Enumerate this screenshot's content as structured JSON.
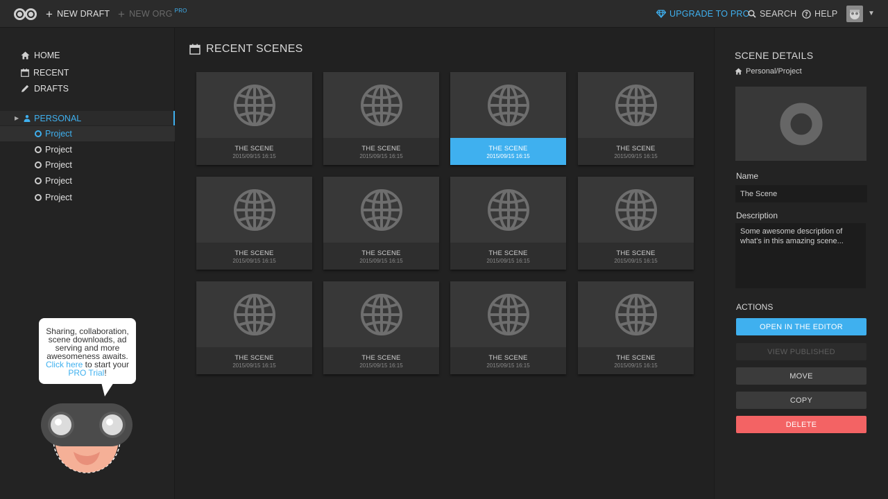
{
  "topbar": {
    "new_draft": "NEW DRAFT",
    "new_org": "NEW ORG",
    "pro_tag": "PRO",
    "upgrade": "UPGRADE TO PRO",
    "search": "SEARCH",
    "help": "HELP"
  },
  "sidebar": {
    "nav": [
      {
        "label": "HOME",
        "icon": "home-icon"
      },
      {
        "label": "RECENT",
        "icon": "calendar-icon"
      },
      {
        "label": "DRAFTS",
        "icon": "pencil-icon"
      }
    ],
    "personal": "PERSONAL",
    "projects": [
      {
        "label": "Project",
        "selected": true
      },
      {
        "label": "Project",
        "selected": false
      },
      {
        "label": "Project",
        "selected": false
      },
      {
        "label": "Project",
        "selected": false
      },
      {
        "label": "Project",
        "selected": false
      }
    ],
    "promo": {
      "text1": "Sharing, collaboration, scene downloads, ad serving and more awesomeness awaits.",
      "link1": "Click here",
      "text2": "to start your",
      "link2": "PRO Trial",
      "text3": "!"
    }
  },
  "main": {
    "title": "RECENT SCENES",
    "scenes": [
      {
        "title": "THE SCENE",
        "date": "2015/09/15 16:15",
        "active": false
      },
      {
        "title": "THE SCENE",
        "date": "2015/09/15 16:15",
        "active": false
      },
      {
        "title": "THE SCENE",
        "date": "2015/09/15 16:15",
        "active": true
      },
      {
        "title": "THE SCENE",
        "date": "2015/09/15 16:15",
        "active": false
      },
      {
        "title": "THE SCENE",
        "date": "2015/09/15 16:15",
        "active": false
      },
      {
        "title": "THE SCENE",
        "date": "2015/09/15 16:15",
        "active": false
      },
      {
        "title": "THE SCENE",
        "date": "2015/09/15 16:15",
        "active": false
      },
      {
        "title": "THE SCENE",
        "date": "2015/09/15 16:15",
        "active": false
      },
      {
        "title": "THE SCENE",
        "date": "2015/09/15 16:15",
        "active": false
      },
      {
        "title": "THE SCENE",
        "date": "2015/09/15 16:15",
        "active": false
      },
      {
        "title": "THE SCENE",
        "date": "2015/09/15 16:15",
        "active": false
      },
      {
        "title": "THE SCENE",
        "date": "2015/09/15 16:15",
        "active": false
      }
    ]
  },
  "details": {
    "title": "SCENE DETAILS",
    "path": "Personal/Project",
    "name_label": "Name",
    "name_value": "The Scene",
    "description_label": "Description",
    "description_value": "Some awesome description of what's in this amazing scene...",
    "actions_label": "ACTIONS",
    "buttons": {
      "open": "OPEN IN THE EDITOR",
      "view": "VIEW PUBLISHED",
      "move": "MOVE",
      "copy": "COPY",
      "delete": "DELETE"
    }
  },
  "colors": {
    "accent": "#3fb0ef",
    "danger": "#f36364",
    "background": "#212121"
  }
}
